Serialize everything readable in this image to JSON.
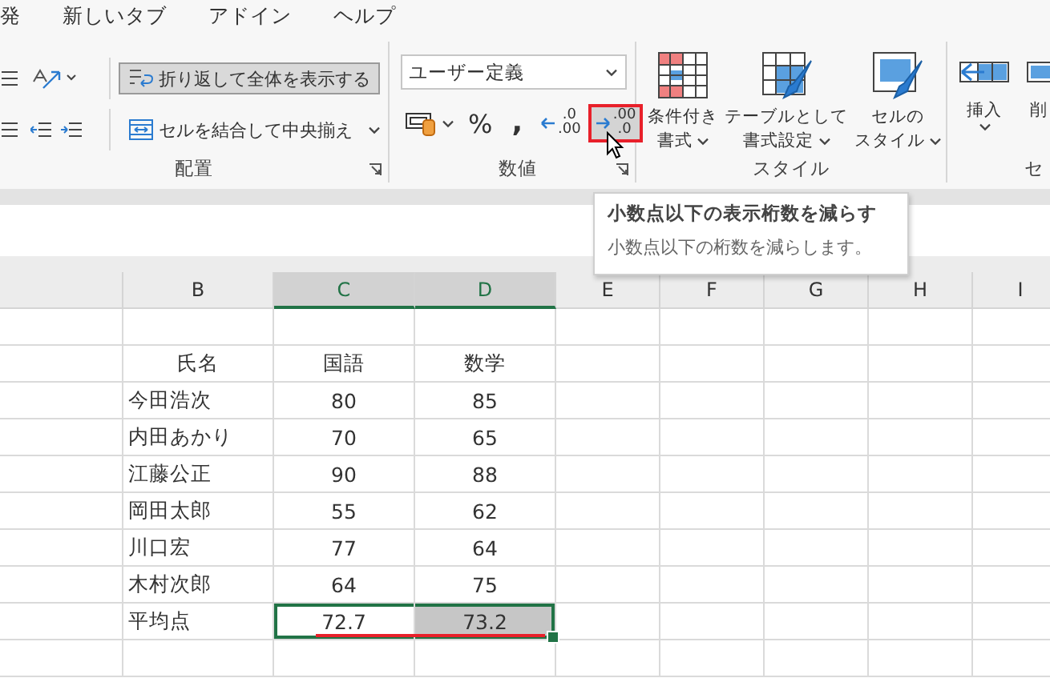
{
  "ribbon_tabs": [
    {
      "label": "発"
    },
    {
      "label": "新しいタブ"
    },
    {
      "label": "アドイン"
    },
    {
      "label": "ヘルプ"
    }
  ],
  "alignment_group": {
    "label": "配置",
    "wrap_text": {
      "label": "折り返して全体を表示する",
      "on": true
    },
    "merge": {
      "label": "セルを結合して中央揃え",
      "on": false
    }
  },
  "number_group": {
    "label": "数値",
    "format": {
      "value": "ユーザー定義"
    },
    "buttons": [
      {
        "kind": "currency",
        "hovered": false
      },
      {
        "kind": "percent",
        "label": "%",
        "hovered": false
      },
      {
        "kind": "comma",
        "label": ",",
        "hovered": false
      },
      {
        "kind": "decimal_increase",
        "upper": ".0",
        "lower": ".00",
        "hovered": false
      },
      {
        "kind": "decimal_decrease",
        "upper": ".00",
        "lower": ".0",
        "hovered": true
      }
    ]
  },
  "styles_group": {
    "label": "スタイル",
    "buttons": [
      {
        "kind": "conditional",
        "lines": [
          "条件付き",
          "書式"
        ]
      },
      {
        "kind": "table",
        "lines": [
          "テーブルとして",
          "書式設定"
        ]
      },
      {
        "kind": "cell_style",
        "lines": [
          "セルの",
          "スタイル"
        ]
      }
    ]
  },
  "cells_group": {
    "label": "セ",
    "buttons": [
      {
        "kind": "insert",
        "label": "挿入"
      },
      {
        "kind": "delete",
        "label": "削"
      }
    ]
  },
  "tooltip": {
    "title": "小数点以下の表示桁数を減らす",
    "description": "小数点以下の桁数を減らします。"
  },
  "sheet": {
    "columns": [
      {
        "label": "B",
        "selected": false
      },
      {
        "label": "C",
        "selected": true
      },
      {
        "label": "D",
        "selected": true
      },
      {
        "label": "E",
        "selected": false
      },
      {
        "label": "F",
        "selected": false
      },
      {
        "label": "G",
        "selected": false
      },
      {
        "label": "H",
        "selected": false
      },
      {
        "label": "I",
        "selected": false
      }
    ],
    "rows": [
      {
        "kind": "header",
        "cells": [
          {
            "text": "氏名",
            "selected": false,
            "active": false
          },
          {
            "text": "国語",
            "selected": false,
            "active": false
          },
          {
            "text": "数学",
            "selected": false,
            "active": false
          }
        ]
      },
      {
        "kind": "data",
        "cells": [
          {
            "text": "今田浩次",
            "selected": false,
            "active": false
          },
          {
            "text": "80",
            "selected": false,
            "active": false
          },
          {
            "text": "85",
            "selected": false,
            "active": false
          }
        ]
      },
      {
        "kind": "data",
        "cells": [
          {
            "text": "内田あかり",
            "selected": false,
            "active": false
          },
          {
            "text": "70",
            "selected": false,
            "active": false
          },
          {
            "text": "65",
            "selected": false,
            "active": false
          }
        ]
      },
      {
        "kind": "data",
        "cells": [
          {
            "text": "江藤公正",
            "selected": false,
            "active": false
          },
          {
            "text": "90",
            "selected": false,
            "active": false
          },
          {
            "text": "88",
            "selected": false,
            "active": false
          }
        ]
      },
      {
        "kind": "data",
        "cells": [
          {
            "text": "岡田太郎",
            "selected": false,
            "active": false
          },
          {
            "text": "55",
            "selected": false,
            "active": false
          },
          {
            "text": "62",
            "selected": false,
            "active": false
          }
        ]
      },
      {
        "kind": "data",
        "cells": [
          {
            "text": "川口宏",
            "selected": false,
            "active": false
          },
          {
            "text": "77",
            "selected": false,
            "active": false
          },
          {
            "text": "64",
            "selected": false,
            "active": false
          }
        ]
      },
      {
        "kind": "data",
        "cells": [
          {
            "text": "木村次郎",
            "selected": false,
            "active": false
          },
          {
            "text": "64",
            "selected": false,
            "active": false
          },
          {
            "text": "75",
            "selected": false,
            "active": false
          }
        ]
      },
      {
        "kind": "data",
        "underlined": true,
        "cells": [
          {
            "text": "平均点",
            "selected": false,
            "active": false
          },
          {
            "text": "72.7",
            "selected": true,
            "active": true
          },
          {
            "text": "73.2",
            "selected": true,
            "active": false
          }
        ]
      }
    ]
  }
}
